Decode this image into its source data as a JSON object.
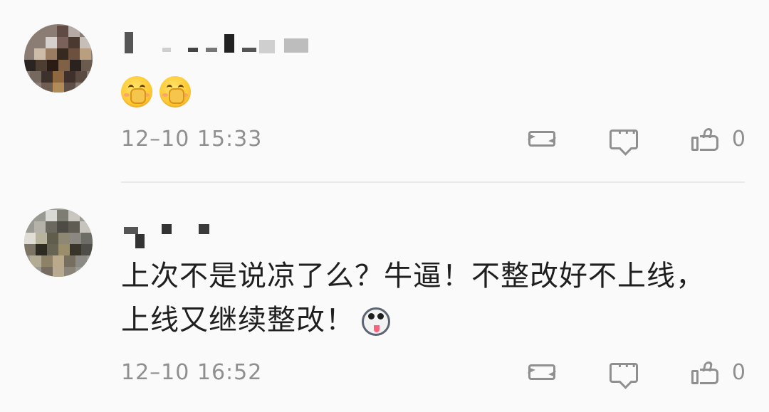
{
  "comments": [
    {
      "content_text": "",
      "timestamp": "12–10 15:33",
      "like_count": "0",
      "emoji_names": [
        "blushing-hand-emoji",
        "blushing-hand-emoji"
      ]
    },
    {
      "content_text": "上次不是说凉了么？牛逼！不整改好不上线，上线又继续整改！",
      "timestamp": "12–10 16:52",
      "like_count": "0",
      "emoji_names": [
        "husky-emoji"
      ]
    }
  ],
  "icons": {
    "repost": "repost-icon",
    "comment": "comment-icon",
    "like": "thumbs-up-icon"
  },
  "colors": {
    "background": "#fafafa",
    "text": "#1f1f1f",
    "meta": "#8f8f8f",
    "separator": "#e9e9e9"
  }
}
